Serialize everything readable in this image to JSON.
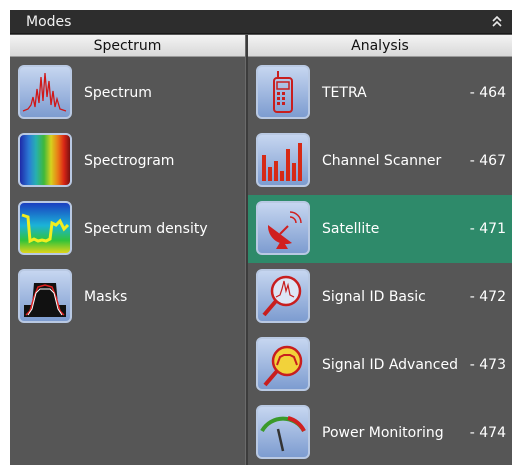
{
  "panel": {
    "title": "Modes",
    "collapse_glyph": "⌃⌃"
  },
  "columns": {
    "left_header": "Spectrum",
    "right_header": "Analysis"
  },
  "spectrum_modes": [
    {
      "label": "Spectrum",
      "icon": "spectrum-icon"
    },
    {
      "label": "Spectrogram",
      "icon": "spectrogram-icon"
    },
    {
      "label": "Spectrum density",
      "icon": "spectrum-density-icon"
    },
    {
      "label": "Masks",
      "icon": "masks-icon"
    }
  ],
  "analysis_modes": [
    {
      "label": "TETRA",
      "number": "- 464",
      "icon": "radio-handset-icon"
    },
    {
      "label": "Channel Scanner",
      "number": "- 467",
      "icon": "channel-bars-icon"
    },
    {
      "label": "Satellite",
      "number": "- 471",
      "icon": "satellite-dish-icon",
      "selected": true
    },
    {
      "label": "Signal ID Basic",
      "number": "- 472",
      "icon": "magnifier-signal-icon"
    },
    {
      "label": "Signal ID Advanced",
      "number": "- 473",
      "icon": "magnifier-signal-advanced-icon"
    },
    {
      "label": "Power Monitoring",
      "number": "- 474",
      "icon": "gauge-icon"
    }
  ],
  "colors": {
    "panel_bg": "#565656",
    "titlebar_bg": "#2d2d2d",
    "selected_row": "#2e8a6a",
    "icon_blue": "#7d9cd0"
  }
}
